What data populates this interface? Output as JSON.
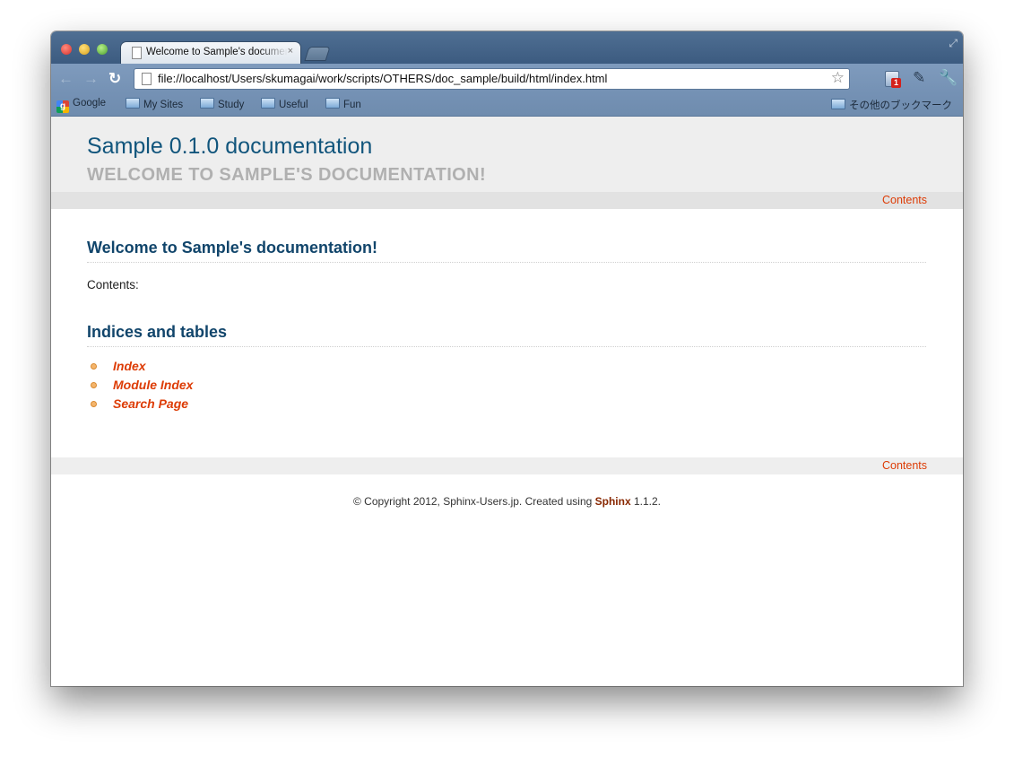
{
  "browser": {
    "tab_title": "Welcome to Sample's documentation!",
    "tab_close": "×",
    "url": "file://localhost/Users/skumagai/work/scripts/OTHERS/doc_sample/build/html/index.html",
    "back_glyph": "←",
    "forward_glyph": "→",
    "reload_glyph": "↻",
    "star_glyph": "☆",
    "resize_glyph": "⤢",
    "extension_badge": "1",
    "extension2_glyph": "✎",
    "wrench_glyph": "🔧",
    "bookmarks": {
      "google": "Google",
      "google_letter": "g",
      "my_sites": "My Sites",
      "study": "Study",
      "useful": "Useful",
      "fun": "Fun",
      "other": "その他のブックマーク"
    }
  },
  "doc": {
    "site_title": "Sample 0.1.0 documentation",
    "site_subtitle": "WELCOME TO SAMPLE'S DOCUMENTATION!",
    "relbar_contents": "Contents",
    "heading1": "Welcome to Sample's documentation!",
    "contents_label": "Contents:",
    "heading2": "Indices and tables",
    "links": {
      "index": "Index",
      "module_index": "Module Index",
      "search_page": "Search Page"
    },
    "footer": {
      "prefix": "© Copyright 2012, Sphinx-Users.jp. Created using ",
      "sphinx": "Sphinx",
      "suffix": " 1.1.2."
    }
  },
  "colors": {
    "title": "#11557c",
    "link": "#dd3c06",
    "subtitle": "#b0b0b0"
  }
}
